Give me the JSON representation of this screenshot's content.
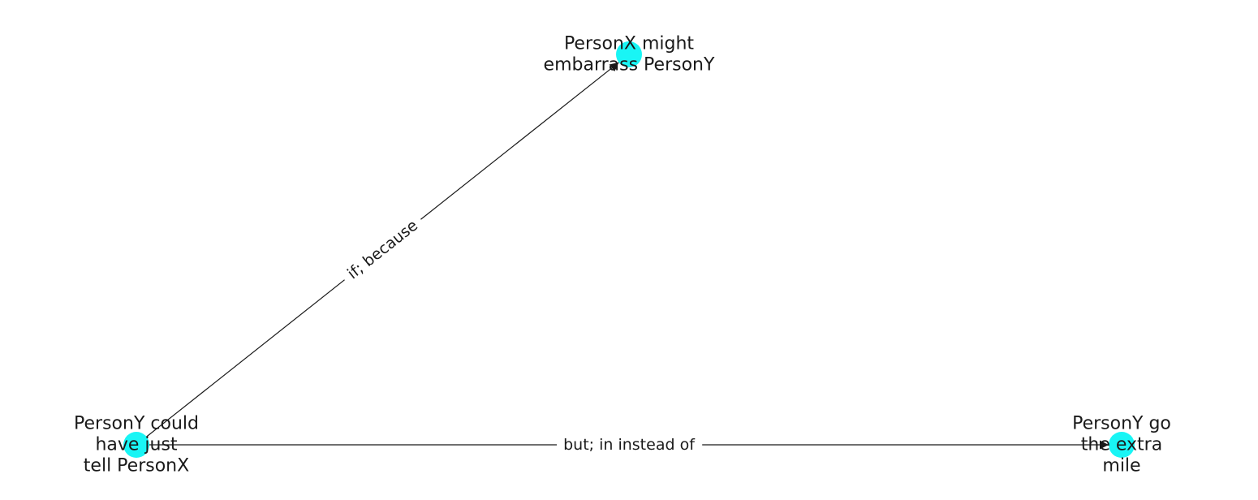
{
  "colors": {
    "node_fill": "#19f5f5",
    "edge": "#1a1a1a",
    "background": "#ffffff"
  },
  "graph": {
    "nodes": [
      {
        "id": "n_embarrass",
        "label_lines": [
          "PersonX might",
          "embarrass PersonY"
        ]
      },
      {
        "id": "n_tell",
        "label_lines": [
          "PersonY could",
          "have just",
          "tell PersonX"
        ]
      },
      {
        "id": "n_extra",
        "label_lines": [
          "PersonY go",
          "the extra",
          "mile"
        ]
      }
    ],
    "edges": [
      {
        "id": "e_if_because",
        "source": "n_tell",
        "target": "n_embarrass",
        "label": "if;  because"
      },
      {
        "id": "e_but_instead",
        "source": "n_tell",
        "target": "n_extra",
        "label": "but;  in instead of"
      }
    ]
  }
}
